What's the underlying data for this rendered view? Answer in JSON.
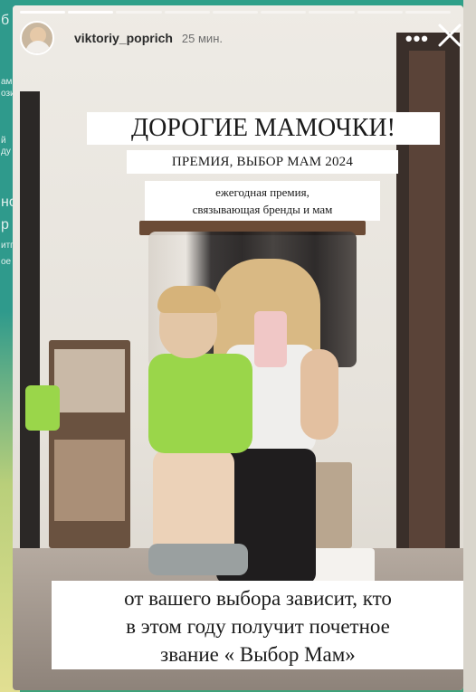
{
  "story": {
    "username": "viktoriy_poprich",
    "time": "25 мин.",
    "more_label": "•••",
    "title": "ДОРОГИЕ МАМОЧКИ!",
    "subtitle": "ПРЕМИЯ, ВЫБОР МАМ 2024",
    "description_line1": "ежегодная премия,",
    "description_line2": "связывающая бренды и мам",
    "bottom_line1": "от вашего выбора зависит, кто",
    "bottom_line2": "в этом году получит почетное",
    "bottom_line3": "звание « Выбор Мам»"
  },
  "background_left_text": [
    "б",
    "ами",
    "ози",
    "й",
    "ду",
    "но",
    "р",
    "итг",
    "ое"
  ],
  "colors": {
    "accent_bg": "#2f9a8c",
    "text_box_bg": "#ffffff",
    "text_color": "#1a1a1a"
  },
  "icons": {
    "close": "close-icon",
    "more": "more-horizontal-icon",
    "avatar": "avatar"
  }
}
